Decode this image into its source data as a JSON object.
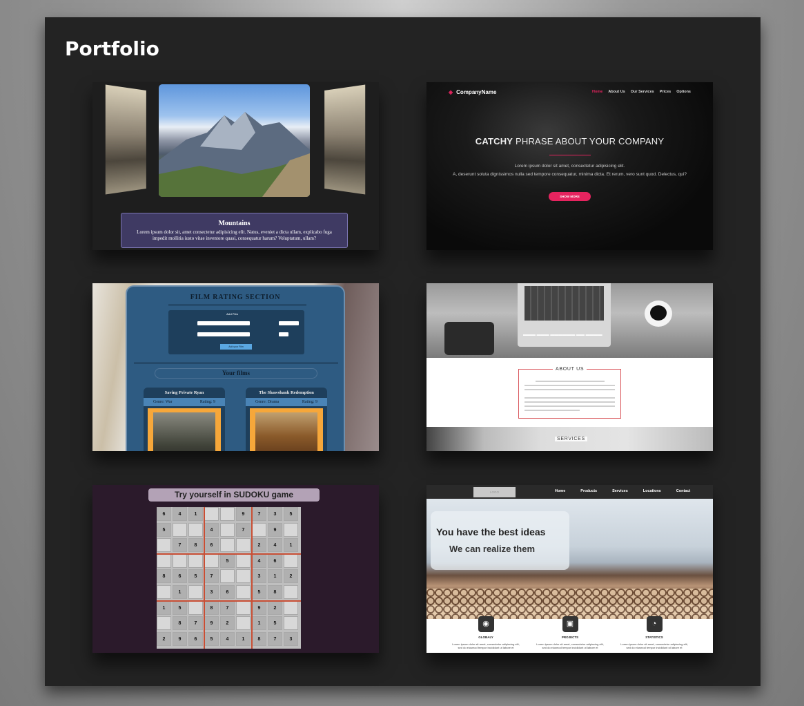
{
  "page": {
    "title": "Portfolio"
  },
  "tile1": {
    "card_title": "Mountains",
    "card_text": "Lorem ipsum dolor sit, amet consectetur adipisicing elit. Natus, eveniet a dicta ullam, explicabo fuga impedit mollitia iusto vitae inventore quasi, consequatur harum? Voluptatum, ullam?"
  },
  "tile2": {
    "brand": "CompanyName",
    "nav": [
      "Home",
      "About Us",
      "Our Services",
      "Prices",
      "Options"
    ],
    "headline_bold": "CATCHY",
    "headline_rest": " PHRASE ABOUT YOUR COMPANY",
    "line1": "Lorem ipsum dolor sit amet, consectetur adipisicing elit.",
    "line2": "A, deserunt soluta dignissimos nulla sed tempore consequatur, minima dicta. Et rerum, vero sunt quod. Delectus, qui?",
    "button": "SHOW MORE",
    "accent": "#e6245f"
  },
  "tile3": {
    "section_title": "FILM RATING SECTION",
    "form_title": "Add Film",
    "add_button": "Add your Film",
    "your_films": "Your films",
    "movies": [
      {
        "title": "Saving Private Ryan",
        "genre": "Genre: War",
        "rating": "Rating: 9"
      },
      {
        "title": "The Shawshank Redemption",
        "genre": "Genre: Drama",
        "rating": "Rating: 9"
      }
    ]
  },
  "tile4": {
    "about_title": "ABOUT US",
    "services_title": "SERVICES"
  },
  "tile5": {
    "title": "Try yourself in SUDOKU game",
    "rows": [
      [
        "6",
        "4",
        "1",
        "",
        "",
        "9",
        "7",
        "3",
        "5"
      ],
      [
        "5",
        "",
        "",
        "4",
        "",
        "7",
        "",
        "9",
        ""
      ],
      [
        "",
        "7",
        "8",
        "6",
        "",
        "",
        "2",
        "4",
        "1"
      ],
      [
        "",
        "",
        "",
        "",
        "5",
        "",
        "4",
        "6",
        ""
      ],
      [
        "8",
        "6",
        "5",
        "7",
        "",
        "",
        "3",
        "1",
        "2"
      ],
      [
        "",
        "1",
        "",
        "3",
        "6",
        "",
        "5",
        "8",
        ""
      ],
      [
        "1",
        "5",
        "",
        "8",
        "7",
        "",
        "9",
        "2",
        ""
      ],
      [
        "",
        "8",
        "7",
        "9",
        "2",
        "",
        "1",
        "5",
        ""
      ],
      [
        "2",
        "9",
        "6",
        "5",
        "4",
        "1",
        "8",
        "7",
        "3"
      ]
    ]
  },
  "tile6": {
    "logo": "LOGO",
    "nav": [
      "Home",
      "Products",
      "Services",
      "Locations",
      "Contact"
    ],
    "headline": "You have the best ideas",
    "subheadline": "We can realize them",
    "features": [
      {
        "label": "GLOBALY",
        "icon": "globe-icon",
        "glyph": "◉"
      },
      {
        "label": "PROJECTS",
        "icon": "briefcase-icon",
        "glyph": "▣"
      },
      {
        "label": "STATISTICS",
        "icon": "pie-chart-icon",
        "glyph": "◔"
      }
    ],
    "feature_text": "Lorem ipsum dolor sit amet, consectetur adipiscing elit, sed do eiusmod tempor incididunt ut labore et"
  }
}
